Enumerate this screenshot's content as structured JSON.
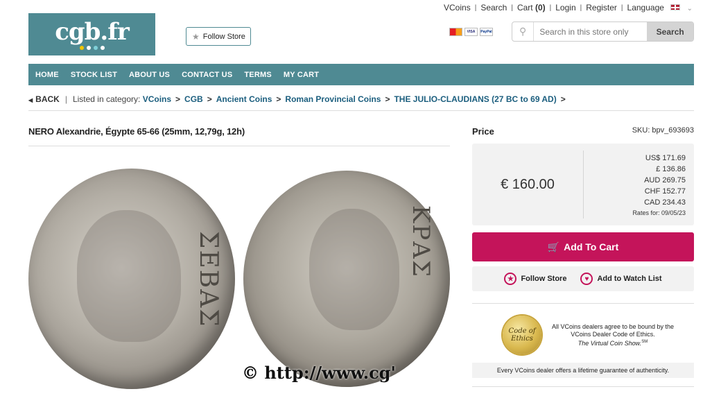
{
  "top_links": {
    "vcoins": "VCoins",
    "search": "Search",
    "cart_label": "Cart",
    "cart_count": "(0)",
    "login": "Login",
    "register": "Register",
    "language": "Language"
  },
  "logo": {
    "text": "cgb.fr",
    "dot_colors": [
      "#f2c500",
      "#ffffff",
      "#7fd0d8",
      "#ffffff"
    ]
  },
  "follow_store_top": "Follow Store",
  "payment_cards": [
    "",
    "VISA",
    "PayPal"
  ],
  "search": {
    "placeholder": "Search in this store only",
    "button": "Search"
  },
  "nav": [
    "HOME",
    "STOCK LIST",
    "ABOUT US",
    "CONTACT US",
    "TERMS",
    "MY CART"
  ],
  "breadcrumb": {
    "back": "BACK",
    "listed_in": "Listed in category:",
    "items": [
      "VCoins",
      "CGB",
      "Ancient Coins",
      "Roman Provincial Coins",
      "THE JULIO-CLAUDIANS (27 BC to 69 AD)"
    ]
  },
  "product": {
    "title": "NERO Alexandrie, Égypte 65-66 (25mm, 12,79g, 12h)",
    "watermark": "© http://www.cg'",
    "obverse_legend": "ΣΕΒΑΣ",
    "reverse_legend": "ΚΡΑΣ"
  },
  "price": {
    "label": "Price",
    "sku": "SKU: bpv_693693",
    "main": "€ 160.00",
    "conversions": [
      "US$ 171.69",
      "£ 136.86",
      "AUD 269.75",
      "CHF 152.77",
      "CAD 234.43"
    ],
    "rates_for": "Rates for: 09/05/23"
  },
  "add_to_cart": "Add To Cart",
  "actions": {
    "follow": "Follow Store",
    "watch": "Add to Watch List"
  },
  "ethics": {
    "seal": "Code of Ethics",
    "line1": "All VCoins dealers agree to be bound by the VCoins Dealer Code of Ethics.",
    "line2": "The Virtual Coin Show.",
    "sup": "SM",
    "guarantee": "Every VCoins dealer offers a lifetime guarantee of authenticity."
  },
  "colors": {
    "brand_teal": "#4f8a93",
    "cart_magenta": "#c4145a",
    "link_blue": "#1b5e7e"
  }
}
